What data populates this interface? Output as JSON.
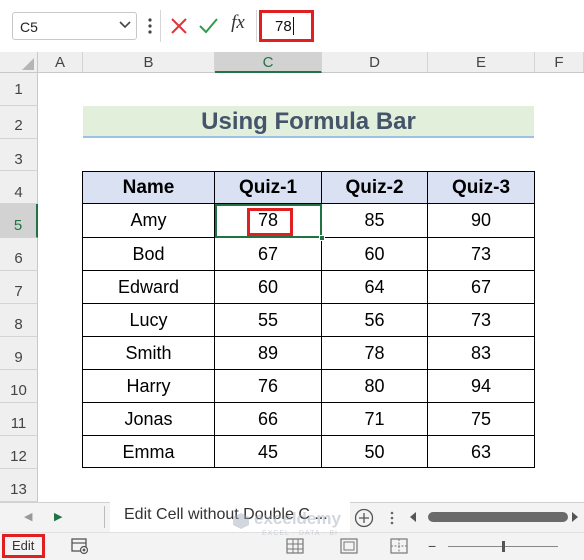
{
  "formula_bar": {
    "name_box": "C5",
    "fx_label": "fx",
    "value": "78"
  },
  "columns": [
    "A",
    "B",
    "C",
    "D",
    "E",
    "F"
  ],
  "rows": [
    "1",
    "2",
    "3",
    "4",
    "5",
    "6",
    "7",
    "8",
    "9",
    "10",
    "11",
    "12",
    "13"
  ],
  "selected": {
    "column": "C",
    "row": "5"
  },
  "sheet": {
    "title": "Using Formula Bar",
    "headers": [
      "Name",
      "Quiz-1",
      "Quiz-2",
      "Quiz-3"
    ],
    "data": [
      [
        "Amy",
        "78",
        "85",
        "90"
      ],
      [
        "Bod",
        "67",
        "60",
        "73"
      ],
      [
        "Edward",
        "60",
        "64",
        "67"
      ],
      [
        "Lucy",
        "55",
        "56",
        "73"
      ],
      [
        "Smith",
        "89",
        "78",
        "83"
      ],
      [
        "Harry",
        "76",
        "80",
        "94"
      ],
      [
        "Jonas",
        "66",
        "71",
        "75"
      ],
      [
        "Emma",
        "45",
        "50",
        "63"
      ]
    ]
  },
  "tabs": {
    "active_sheet": "Edit Cell without Double C ..."
  },
  "status": {
    "mode": "Edit"
  },
  "watermark": {
    "name": "exceldemy",
    "tagline": "EXCEL · DATA · BI"
  },
  "colors": {
    "accent": "#217346",
    "highlight": "#e02020",
    "title_fill": "#e2efda",
    "header_fill": "#d9e1f2"
  }
}
